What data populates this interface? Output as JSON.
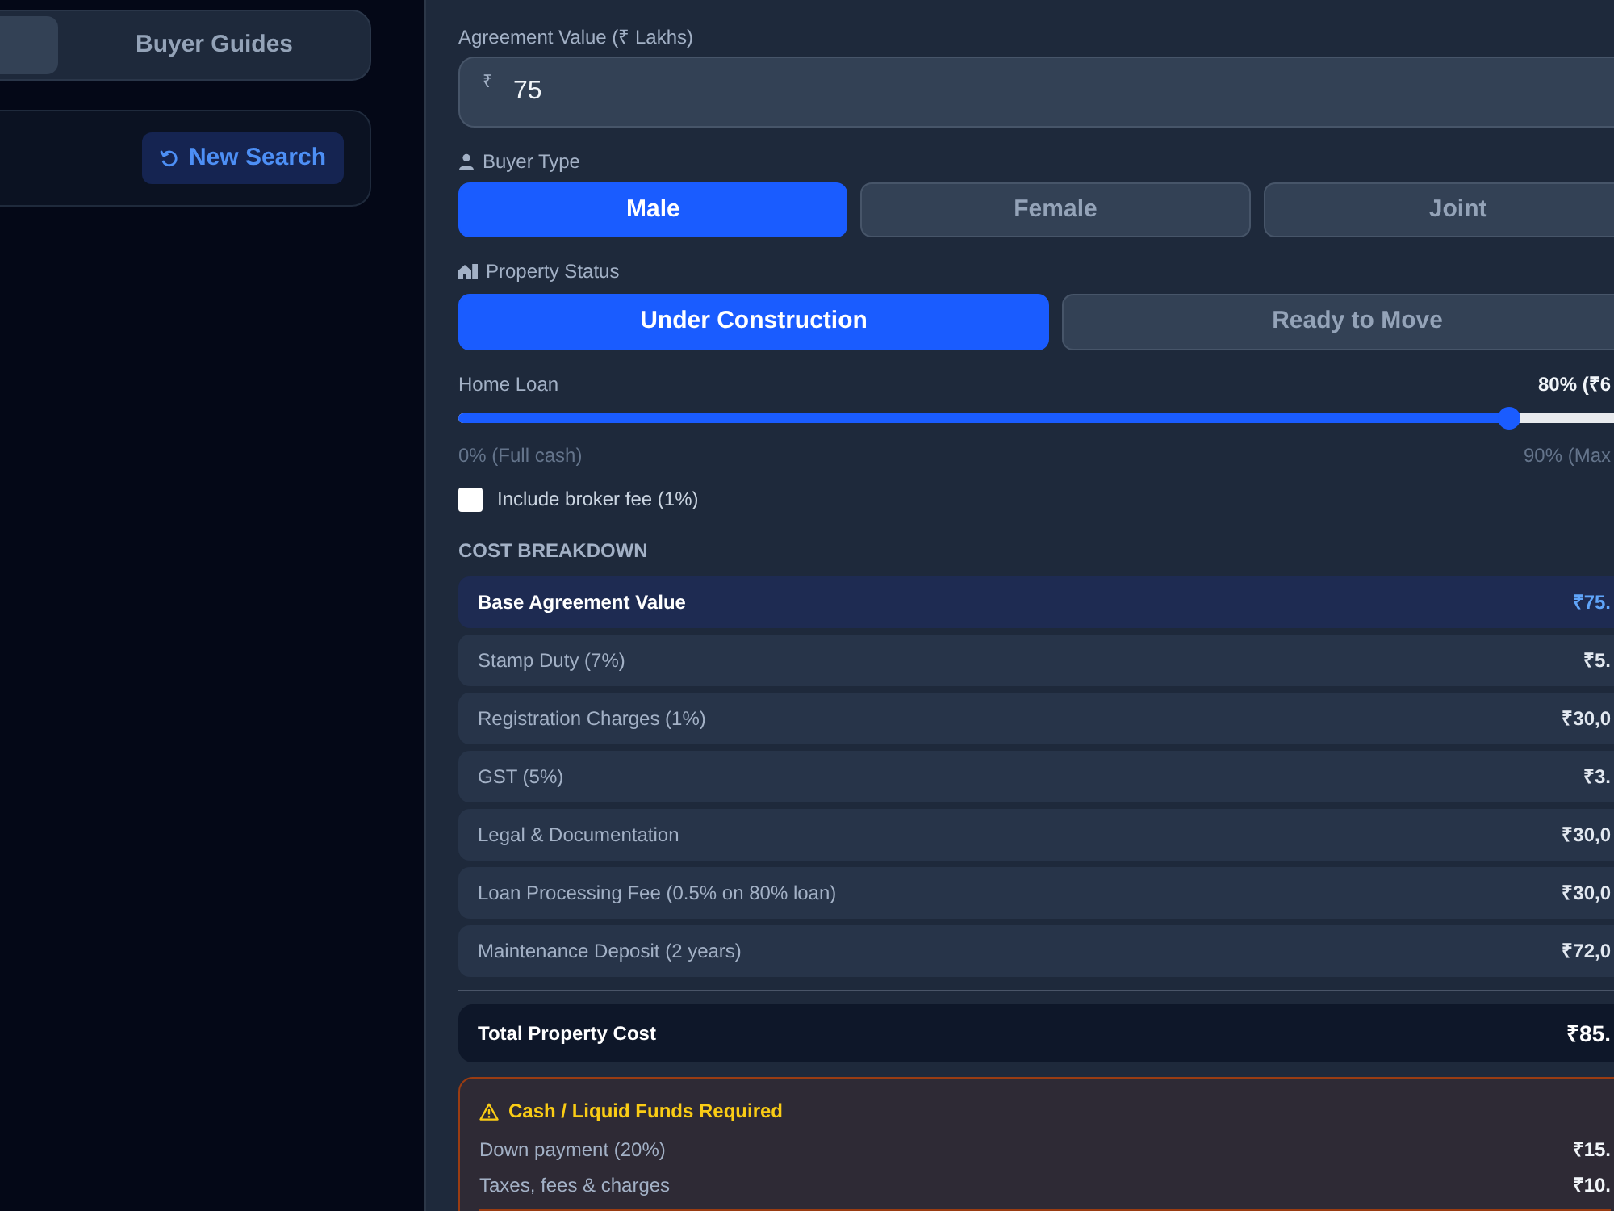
{
  "top_tabs": [
    {
      "selected": true
    },
    {
      "label": "Buyer Guides",
      "selected": false
    }
  ],
  "search_card": {
    "button": "New Search"
  },
  "calculator": {
    "agreement_value": {
      "label": "Agreement Value (₹ Lakhs)",
      "prefix": "₹",
      "value": "75"
    },
    "buyer_type": {
      "label": "Buyer Type",
      "options": [
        {
          "label": "Male",
          "selected": true
        },
        {
          "label": "Female",
          "selected": false
        },
        {
          "label": "Joint",
          "selected": false
        }
      ]
    },
    "property_status": {
      "label": "Property Status",
      "options": [
        {
          "label": "Under Construction",
          "selected": true
        },
        {
          "label": "Ready to Move",
          "selected": false
        }
      ]
    },
    "home_loan": {
      "label": "Home Loan",
      "reading": "80% (₹6",
      "level": 0.88,
      "min_label": "0% (Full cash)",
      "max_label": "90% (Max"
    },
    "broker_fee": {
      "label": "Include broker fee (1%)",
      "checked": false
    },
    "cost_breakdown": {
      "title": "COST BREAKDOWN",
      "rows": [
        {
          "label": "Base Agreement Value",
          "value": "₹75.",
          "highlighted": true
        },
        {
          "label": "Stamp Duty (7%)",
          "value": "₹5.",
          "highlighted": false
        },
        {
          "label": "Registration Charges (1%)",
          "value": "₹30,0",
          "highlighted": false
        },
        {
          "label": "GST (5%)",
          "value": "₹3.",
          "highlighted": false
        },
        {
          "label": "Legal & Documentation",
          "value": "₹30,0",
          "highlighted": false
        },
        {
          "label": "Loan Processing Fee (0.5% on 80% loan)",
          "value": "₹30,0",
          "highlighted": false
        },
        {
          "label": "Maintenance Deposit (2 years)",
          "value": "₹72,0",
          "highlighted": false
        }
      ],
      "total": {
        "label": "Total Property Cost",
        "value": "₹85."
      }
    },
    "cash_required": {
      "title": "Cash / Liquid Funds Required",
      "rows": [
        {
          "label": "Down payment (20%)",
          "value": "₹15."
        },
        {
          "label": "Taxes, fees & charges",
          "value": "₹10."
        }
      ]
    }
  }
}
